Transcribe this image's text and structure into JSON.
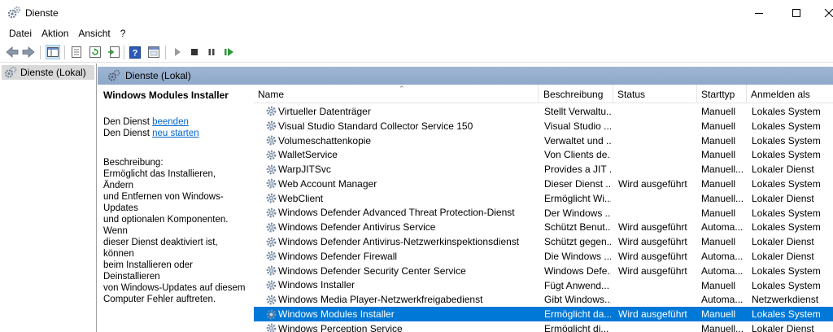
{
  "window": {
    "title": "Dienste"
  },
  "menu": [
    "Datei",
    "Aktion",
    "Ansicht",
    "?"
  ],
  "tree": {
    "root_label": "Dienste (Lokal)"
  },
  "pane": {
    "header": "Dienste (Lokal)"
  },
  "details": {
    "service_name": "Windows Modules Installer",
    "prefix1": "Den Dienst ",
    "link1": "beenden",
    "prefix2": "Den Dienst ",
    "link2": "neu starten",
    "desc_label": "Beschreibung:",
    "desc_text": "Ermöglicht das Installieren, Ändern\nund Entfernen von Windows-Updates\nund optionalen Komponenten. Wenn\ndieser Dienst deaktiviert ist, können\nbeim Installieren oder Deinstallieren\nvon Windows-Updates auf diesem\nComputer Fehler auftreten."
  },
  "table": {
    "columns": [
      "Name",
      "Beschreibung",
      "Status",
      "Starttyp",
      "Anmelden als"
    ],
    "rows": [
      {
        "name": "Virtueller Datenträger",
        "desc": "Stellt Verwaltu...",
        "status": "",
        "start": "Manuell",
        "login": "Lokales System"
      },
      {
        "name": "Visual Studio Standard Collector Service 150",
        "desc": "Visual Studio ...",
        "status": "",
        "start": "Manuell",
        "login": "Lokales System"
      },
      {
        "name": "Volumeschattenkopie",
        "desc": "Verwaltet und ...",
        "status": "",
        "start": "Manuell",
        "login": "Lokales System"
      },
      {
        "name": "WalletService",
        "desc": "Von Clients de...",
        "status": "",
        "start": "Manuell",
        "login": "Lokales System"
      },
      {
        "name": "WarpJITSvc",
        "desc": "Provides a JIT ...",
        "status": "",
        "start": "Manuell...",
        "login": "Lokaler Dienst"
      },
      {
        "name": "Web Account Manager",
        "desc": "Dieser Dienst ...",
        "status": "Wird ausgeführt",
        "start": "Manuell",
        "login": "Lokales System"
      },
      {
        "name": "WebClient",
        "desc": "Ermöglicht Wi...",
        "status": "",
        "start": "Manuell...",
        "login": "Lokaler Dienst"
      },
      {
        "name": "Windows Defender Advanced Threat Protection-Dienst",
        "desc": "Der Windows ...",
        "status": "",
        "start": "Manuell",
        "login": "Lokales System"
      },
      {
        "name": "Windows Defender Antivirus Service",
        "desc": "Schützt Benut...",
        "status": "Wird ausgeführt",
        "start": "Automa...",
        "login": "Lokales System"
      },
      {
        "name": "Windows Defender Antivirus-Netzwerkinspektionsdienst",
        "desc": "Schützt gegen...",
        "status": "Wird ausgeführt",
        "start": "Manuell",
        "login": "Lokaler Dienst"
      },
      {
        "name": "Windows Defender Firewall",
        "desc": "Die Windows ...",
        "status": "Wird ausgeführt",
        "start": "Automa...",
        "login": "Lokaler Dienst"
      },
      {
        "name": "Windows Defender Security Center Service",
        "desc": "Windows Defe...",
        "status": "Wird ausgeführt",
        "start": "Automa...",
        "login": "Lokales System"
      },
      {
        "name": "Windows Installer",
        "desc": "Fügt Anwend...",
        "status": "",
        "start": "Manuell",
        "login": "Lokales System"
      },
      {
        "name": "Windows Media Player-Netzwerkfreigabedienst",
        "desc": "Gibt Windows...",
        "status": "",
        "start": "Automa...",
        "login": "Netzwerkdienst"
      },
      {
        "name": "Windows Modules Installer",
        "desc": "Ermöglicht da...",
        "status": "Wird ausgeführt",
        "start": "Manuell",
        "login": "Lokales System",
        "selected": true
      },
      {
        "name": "Windows Perception Service",
        "desc": "Ermöglicht di...",
        "status": "",
        "start": "Manuell...",
        "login": "Lokaler Dienst"
      }
    ]
  },
  "colors": {
    "selection": "#0078d7",
    "pane_header": "#9fb6d3",
    "link": "#0066cc"
  }
}
